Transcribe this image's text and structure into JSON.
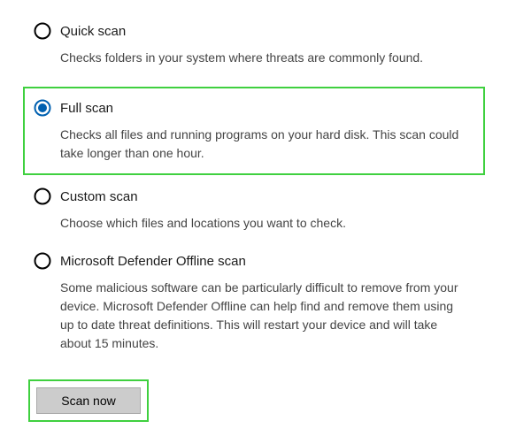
{
  "options": [
    {
      "id": "quick",
      "label": "Quick scan",
      "description": "Checks folders in your system where threats are commonly found."
    },
    {
      "id": "full",
      "label": "Full scan",
      "description": "Checks all files and running programs on your hard disk. This scan could take longer than one hour."
    },
    {
      "id": "custom",
      "label": "Custom scan",
      "description": "Choose which files and locations you want to check."
    },
    {
      "id": "offline",
      "label": "Microsoft Defender Offline scan",
      "description": "Some malicious software can be particularly difficult to remove from your device. Microsoft Defender Offline can help find and remove them using up to date threat definitions. This will restart your device and will take about 15 minutes."
    }
  ],
  "selected": "full",
  "scan_button_label": "Scan now"
}
